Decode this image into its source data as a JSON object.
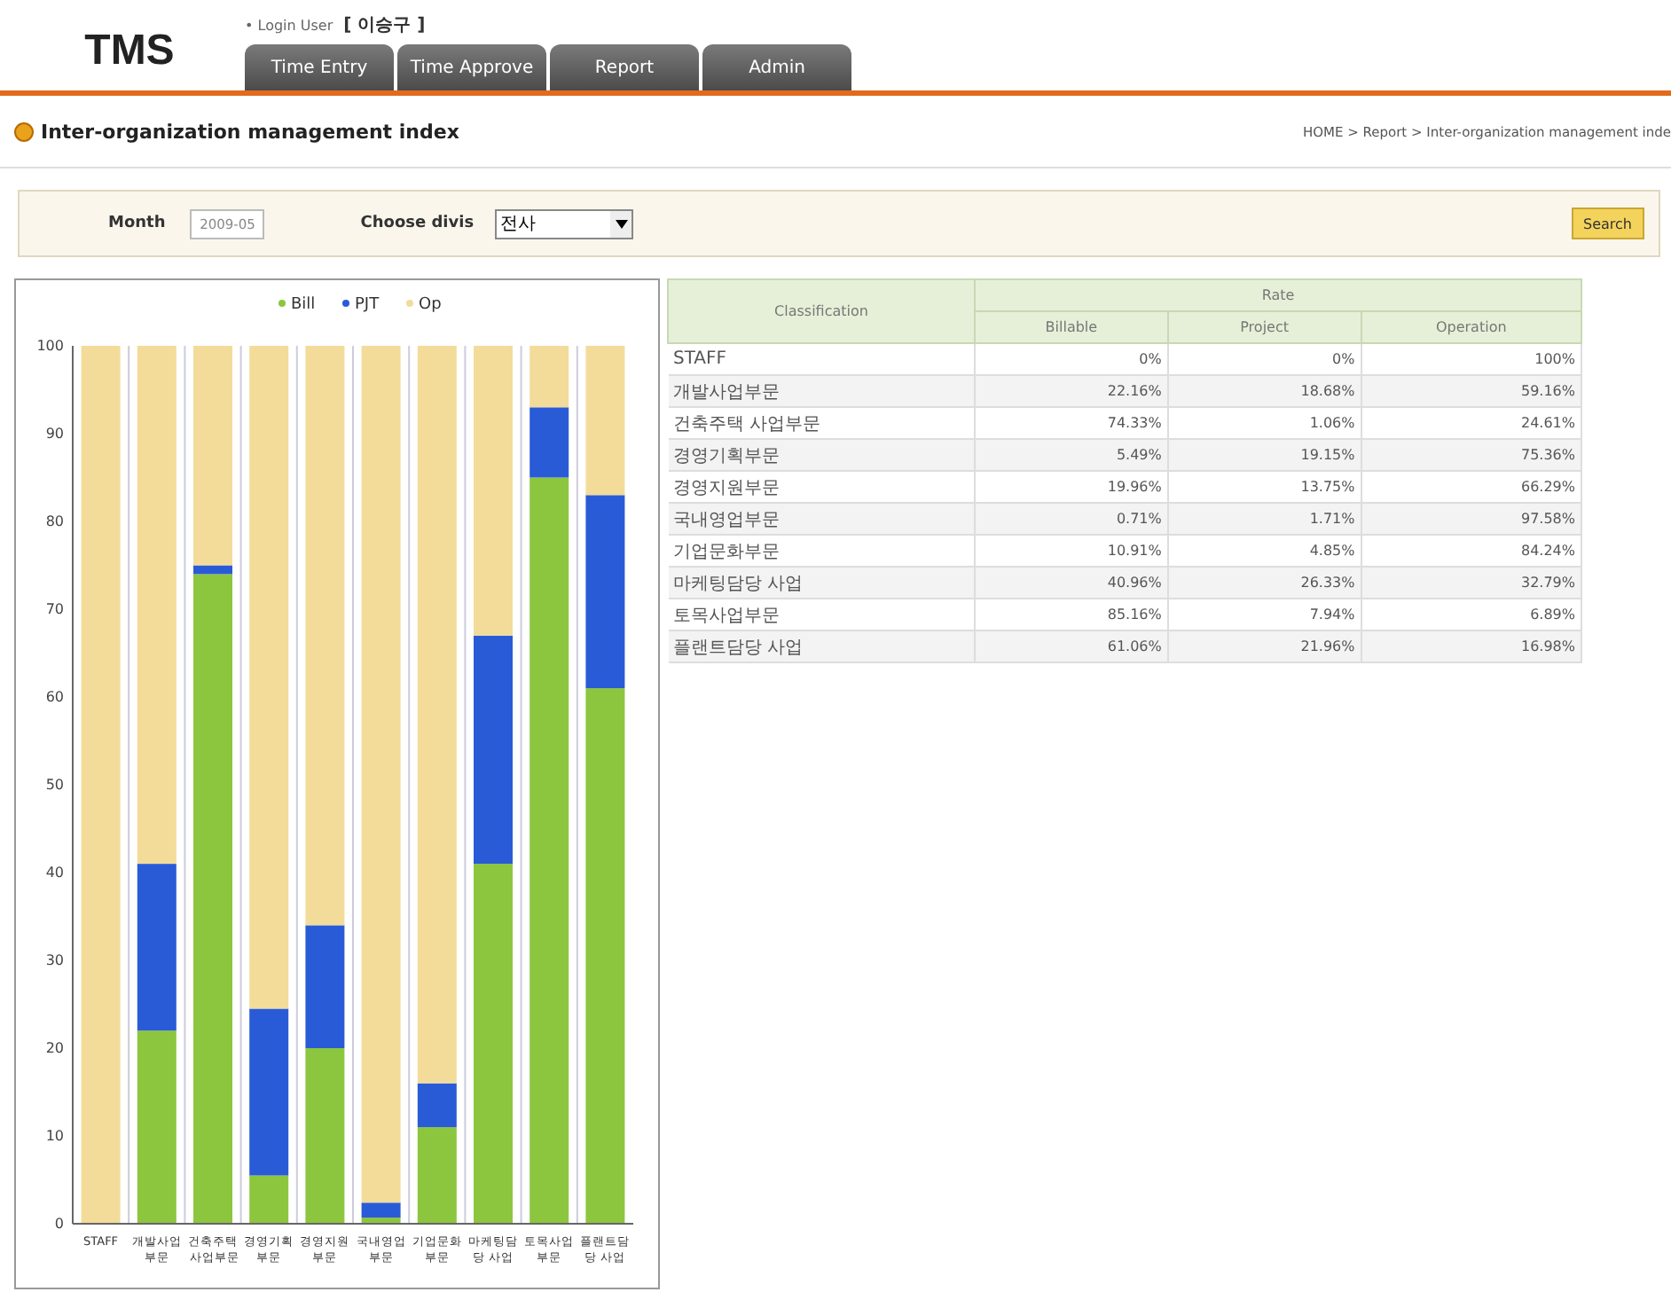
{
  "header": {
    "logo": "TMS",
    "login_label": "• Login User",
    "login_user": "[ 이승구 ]",
    "tabs": [
      {
        "label": "Time Entry",
        "selected": false
      },
      {
        "label": "Time Approve",
        "selected": false
      },
      {
        "label": "Report",
        "selected": false
      },
      {
        "label": "Admin",
        "selected": false
      }
    ]
  },
  "page_title": "Inter-organization management index",
  "breadcrumb": "HOME > Report > Inter-organization management inde",
  "filters": {
    "month_label": "Month",
    "month_value": "2009-05",
    "division_label": "Choose divis",
    "division_value": "전사",
    "search_button": "Search"
  },
  "chart": {
    "chart_data": {
      "type": "bar",
      "stacked": true,
      "orientation": "vertical",
      "categories": [
        "STAFF",
        "개발사업부문",
        "건축주택 사업부문",
        "경영기획부문",
        "경영지원부문",
        "국내영업부문",
        "기업문화부문",
        "마케팅담당 사업",
        "토목사업부문",
        "플랜트담당 사업"
      ],
      "legend": "top",
      "series": [
        {
          "name": "Bill",
          "color": "#8cc63f",
          "values": [
            0,
            22,
            74,
            5.5,
            20,
            0.7,
            11,
            41,
            85,
            61
          ]
        },
        {
          "name": "PJT",
          "color": "#2a5bd7",
          "values": [
            0,
            19,
            1,
            19,
            14,
            1.7,
            5,
            26,
            8,
            22
          ]
        },
        {
          "name": "Op",
          "color": "#f3dc9a",
          "values": [
            100,
            59,
            25,
            75.5,
            66,
            97.6,
            84,
            33,
            7,
            17
          ]
        }
      ],
      "ylim": [
        0,
        100
      ],
      "yticks": [
        0,
        10,
        20,
        30,
        40,
        50,
        60,
        70,
        80,
        90,
        {
          "value": 100,
          "label": "100"
        }
      ]
    }
  },
  "table": {
    "group_header": "Rate",
    "columns": [
      "Classification",
      "Billable",
      "Project",
      "Operation"
    ],
    "rows": [
      [
        "STAFF",
        "0%",
        "0%",
        "100%"
      ],
      [
        "개발사업부문",
        "22.16%",
        "18.68%",
        "59.16%"
      ],
      [
        "건축주택 사업부문",
        "74.33%",
        "1.06%",
        "24.61%"
      ],
      [
        "경영기획부문",
        "5.49%",
        "19.15%",
        "75.36%"
      ],
      [
        "경영지원부문",
        "19.96%",
        "13.75%",
        "66.29%"
      ],
      [
        "국내영업부문",
        "0.71%",
        "1.71%",
        "97.58%"
      ],
      [
        "기업문화부문",
        "10.91%",
        "4.85%",
        "84.24%"
      ],
      [
        "마케팅담당 사업",
        "40.96%",
        "26.33%",
        "32.79%"
      ],
      [
        "토목사업부문",
        "85.16%",
        "7.94%",
        "6.89%"
      ],
      [
        "플랜트담당 사업",
        "61.06%",
        "21.96%",
        "16.98%"
      ]
    ]
  }
}
